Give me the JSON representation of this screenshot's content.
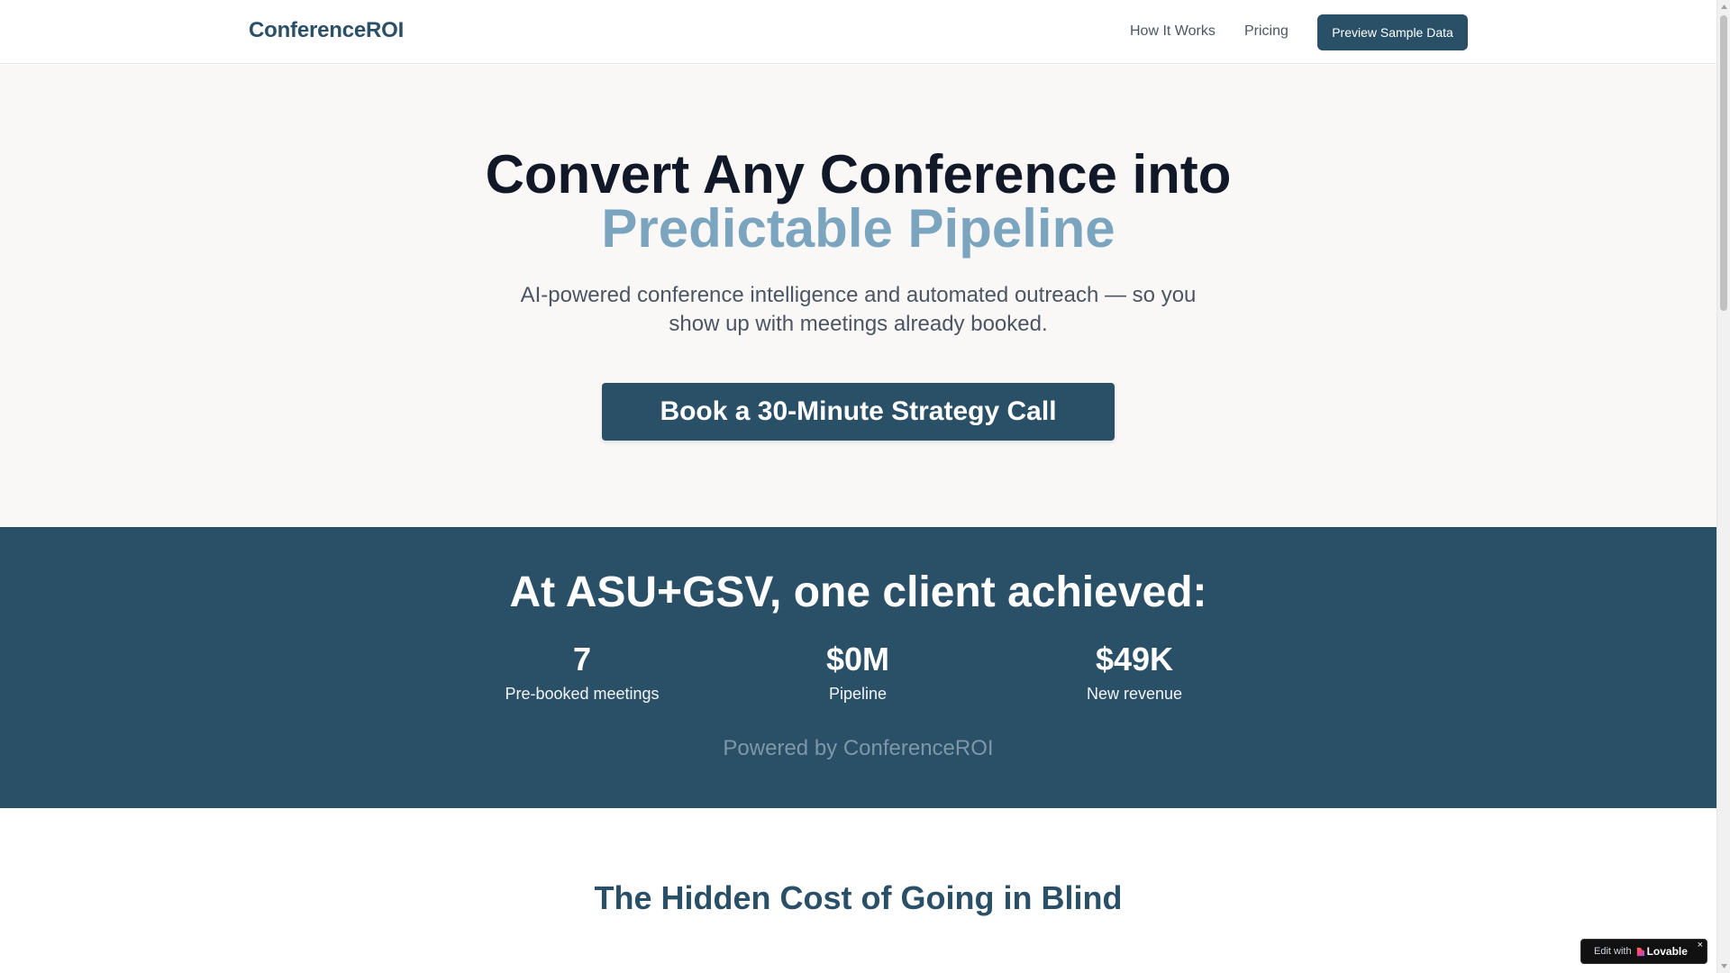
{
  "header": {
    "logo": "ConferenceROI",
    "nav": [
      {
        "label": "How It Works"
      },
      {
        "label": "Pricing"
      }
    ],
    "preview_button": "Preview Sample Data"
  },
  "hero": {
    "title_line1": "Convert Any Conference into",
    "title_line2": "Predictable Pipeline",
    "subtitle": "AI-powered conference intelligence and automated outreach — so you show up with meetings already booked.",
    "cta": "Book a 30-Minute Strategy Call"
  },
  "stats": {
    "title": "At ASU+GSV, one client achieved:",
    "items": [
      {
        "value": "7",
        "label": "Pre-booked meetings"
      },
      {
        "value": "$0M",
        "label": "Pipeline"
      },
      {
        "value": "$49K",
        "label": "New revenue"
      }
    ],
    "powered_by": "Powered by ConferenceROI"
  },
  "section": {
    "title": "The Hidden Cost of Going in Blind"
  },
  "badge": {
    "text": "Edit with",
    "brand": "Lovable",
    "close": "×",
    "icon": "lovable-heart-icon"
  },
  "colors": {
    "primary": "#2a5068",
    "accent": "#7ba5bf",
    "hero_bg": "#f9f8f7"
  }
}
